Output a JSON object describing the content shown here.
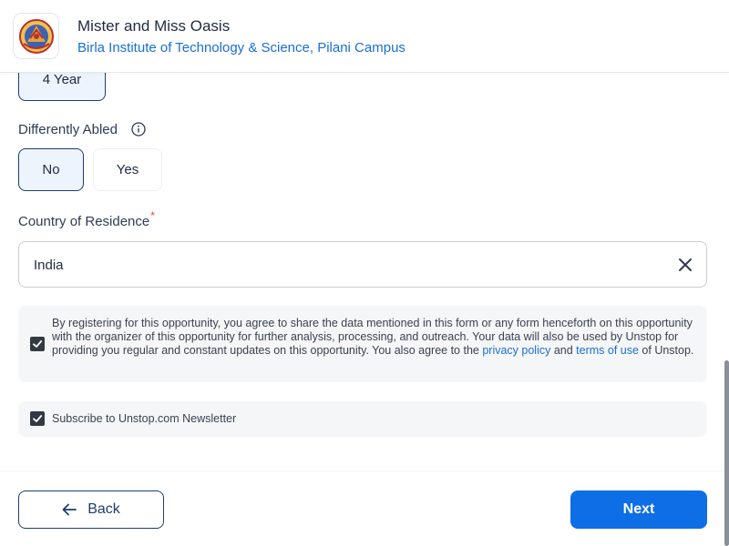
{
  "header": {
    "title": "Mister and Miss Oasis",
    "organization": "Birla Institute of Technology & Science, Pilani Campus"
  },
  "course_duration": {
    "selected_label": "4 Year"
  },
  "differently_abled": {
    "label": "Differently Abled",
    "options": [
      "No",
      "Yes"
    ],
    "selected": "No"
  },
  "country": {
    "label": "Country of Residence",
    "required_mark": "*",
    "value": "India"
  },
  "consent": {
    "checked": true,
    "text_before": "By registering for this opportunity, you agree to share the data mentioned in this form or any form henceforth on this opportunity with the organizer of this opportunity for further analysis, processing, and outreach. Your data will also be used by Unstop for providing you regular and constant updates on this opportunity. You also agree to the ",
    "privacy_link": "privacy policy",
    "text_and": " and ",
    "terms_link": "terms of use",
    "text_after": " of Unstop."
  },
  "newsletter": {
    "checked": true,
    "label": "Subscribe to Unstop.com Newsletter"
  },
  "footer": {
    "back_label": "Back",
    "next_label": "Next"
  },
  "colors": {
    "accent": "#0d6ee6",
    "link": "#1a6fd6",
    "selected_border": "#1d3d6e",
    "required": "#e0453a"
  }
}
